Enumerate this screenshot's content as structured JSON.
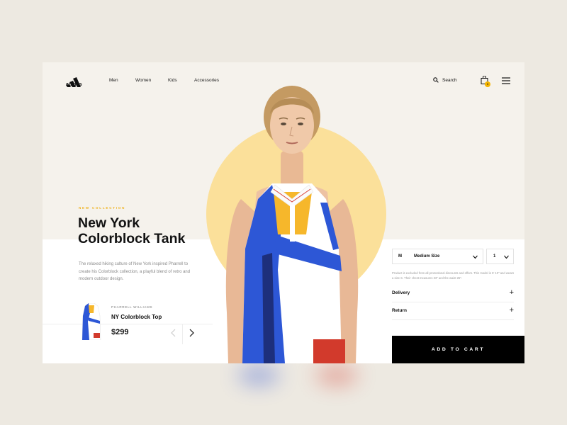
{
  "brand": {
    "logo_text": "adidas"
  },
  "nav": {
    "items": [
      "Men",
      "Women",
      "Kids",
      "Accessories"
    ]
  },
  "header": {
    "search_label": "Search",
    "cart_count": "1"
  },
  "hero": {
    "kicker": "NEW COLLECTION",
    "title_line1": "New York",
    "title_line2": "Colorblock Tank",
    "description": "The relaxed hiking culture of New York inspired Pharrell to create his Colorblock collection, a playful blend of retro and modern outdoor design."
  },
  "featured": {
    "label": "PHARRELL WILLIAMS",
    "title": "NY Colorblock Top",
    "price": "$299"
  },
  "options": {
    "size_abbr": "M",
    "size_name": "Medium Size",
    "quantity": "1",
    "note": "Product is excluded from all promotional discounts and offers. This model is 5' 10\" and wears a size S. Their chest measures 33\" and the waist 25\"."
  },
  "accordion": [
    {
      "label": "Delivery"
    },
    {
      "label": "Return"
    }
  ],
  "cta": {
    "add_to_cart": "ADD TO CART"
  },
  "colors": {
    "accent_yellow": "#f0b21d",
    "circle": "#fbe09a",
    "background": "#ede9e1",
    "panel": "#f5f2ec",
    "button": "#000000"
  },
  "icons": [
    "adidas-logo-icon",
    "search-icon",
    "bag-icon",
    "menu-icon",
    "chevron-down-icon",
    "arrow-left-icon",
    "arrow-right-icon",
    "plus-icon"
  ]
}
